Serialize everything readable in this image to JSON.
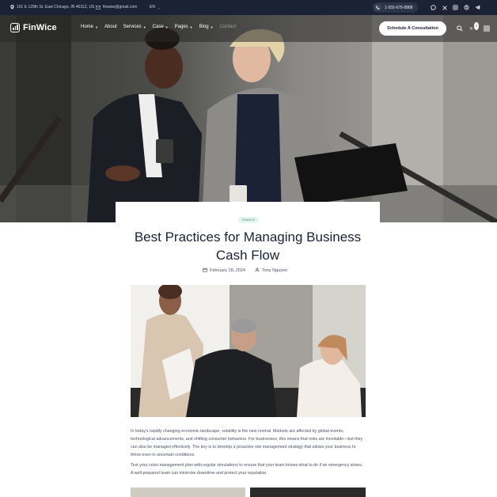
{
  "topbar": {
    "address": "101 E 129th St, East Chicago, IN 46312, US",
    "email": "finwise@gmail.com",
    "language": "EN",
    "phone": "1-555-678-8888",
    "social_icons": [
      "whatsapp-icon",
      "x-icon",
      "instagram-icon",
      "skype-icon",
      "telegram-icon"
    ]
  },
  "header": {
    "logo_text": "FinWice",
    "nav": [
      {
        "label": "Home",
        "has_dropdown": true
      },
      {
        "label": "About",
        "has_dropdown": false
      },
      {
        "label": "Services",
        "has_dropdown": true
      },
      {
        "label": "Case",
        "has_dropdown": true
      },
      {
        "label": "Pages",
        "has_dropdown": true
      },
      {
        "label": "Blog",
        "has_dropdown": true
      },
      {
        "label": "Contact",
        "has_dropdown": false
      }
    ],
    "cta_label": "Schedule A Consultation",
    "cart_count": "0"
  },
  "article": {
    "category": "FINANCE",
    "title": "Best Practices for Managing Business Cash Flow",
    "date": "February 28, 2024",
    "author": "Tony Nguyen",
    "paragraphs": [
      "In today's rapidly changing economic landscape, volatility is the new normal. Markets are affected by global events, technological advancements, and shifting consumer behaviors. For businesses, this means that risks are inevitable—but they can also be managed effectively. The key is to develop a proactive risk management strategy that allows your business to thrive even in uncertain conditions.",
      "Test your crisis management plan with regular simulations to ensure that your team knows what to do if an emergency arises. A well-prepared team can minimize downtime and protect your reputation."
    ]
  },
  "colors": {
    "navy": "#1b2233",
    "badge_bg": "#e6f4ef",
    "badge_text": "#3d8a6c"
  }
}
